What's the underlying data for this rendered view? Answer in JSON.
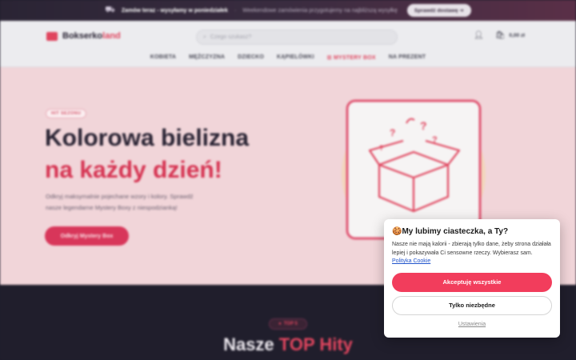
{
  "promo": {
    "shipping": "Zamów teraz - wysyłamy w poniedziałek",
    "sep": "·",
    "note": "Weekendowe zamówienia przygotujemy na najbliższą wysyłkę",
    "check_button": "Sprawdź dostawę",
    "check_arrow": "➔"
  },
  "header": {
    "brand_main": "Bokserko",
    "brand_accent": "land",
    "search_placeholder": "Czego szukasz?",
    "cart_price": "0,00 zł"
  },
  "nav": [
    "KOBIETA",
    "MĘŻCZYZNA",
    "DZIECKO",
    "KĄPIELÓWKI",
    "MYSTERY BOX",
    "NA PREZENT"
  ],
  "hero": {
    "badge": "HIT SEZONU",
    "title_line1": "Kolorowa bielizna",
    "title_line2": "na każdy dzień!",
    "desc_line1": "Odkryj maksymalnie pojechane wzory i kolory. Sprawdź",
    "desc_line2": "nasze legendarne Mystery Boxy z niespodzianką!",
    "cta": "Odkryj Mystery Box"
  },
  "section": {
    "pill": "TOP 5",
    "title_main": "Nasze ",
    "title_accent": "TOP Hity"
  },
  "cookie": {
    "title": "🍪My lubimy ciasteczka, a Ty?",
    "text": "Nasze nie mają kalorii - zbierają tylko dane, żeby strona działała lepiej i pokazywała Ci sensowne rzeczy. Wybierasz sam. ",
    "policy_link": "Polityka Cookie",
    "accept": "Akceptuję wszystkie",
    "necessary": "Tylko niezbędne",
    "settings": "Ustawienia"
  },
  "colors": {
    "accent": "#f23d5c",
    "hero_bg": "#f1d5d9",
    "dark_bg": "#201e2c"
  }
}
